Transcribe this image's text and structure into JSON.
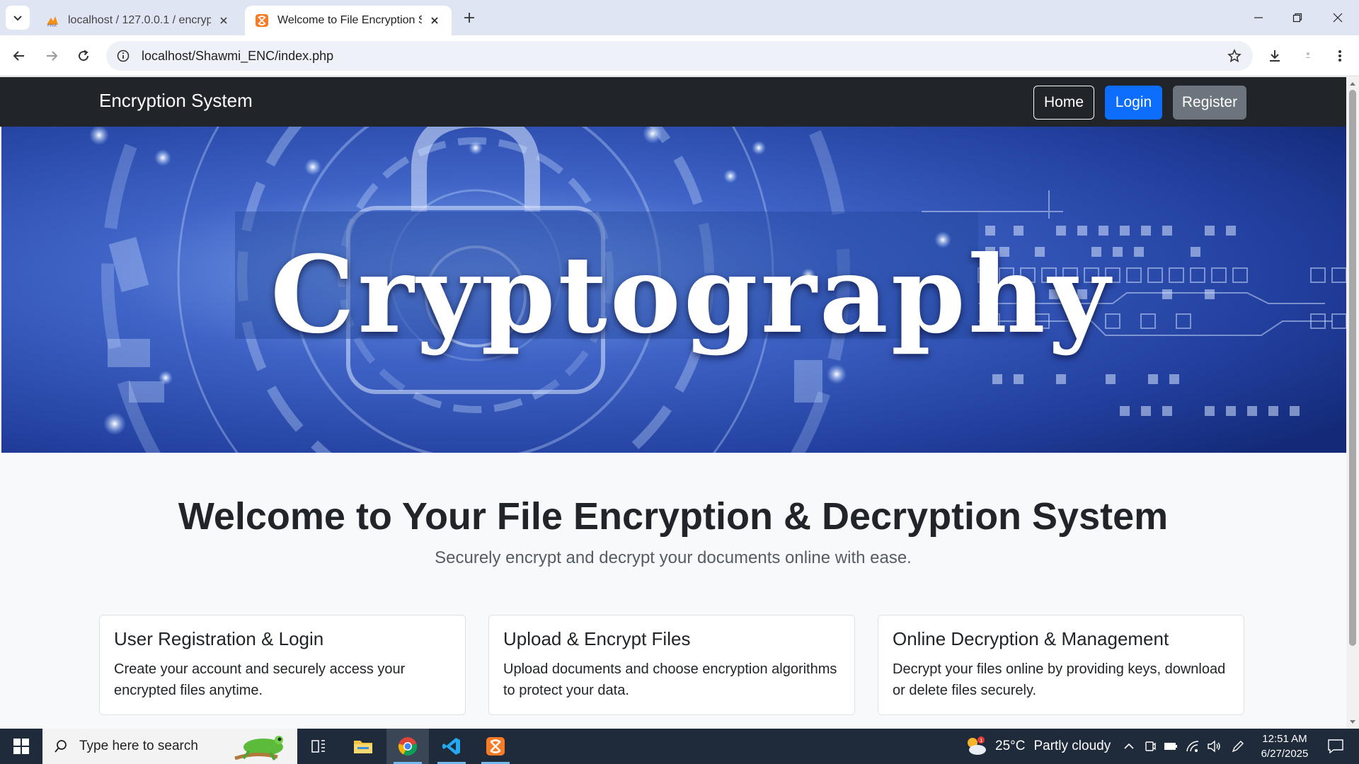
{
  "browser": {
    "tabs": [
      {
        "title": "localhost / 127.0.0.1 / encryptio",
        "favicon": "phpmyadmin-icon",
        "active": false
      },
      {
        "title": "Welcome to File Encryption Syst",
        "favicon": "xampp-icon",
        "active": true
      }
    ],
    "url": "localhost/Shawmi_ENC/index.php"
  },
  "navbar": {
    "brand": "Encryption System",
    "home_label": "Home",
    "login_label": "Login",
    "register_label": "Register"
  },
  "hero": {
    "text": "Cryptography"
  },
  "main": {
    "heading": "Welcome to Your File Encryption & Decryption System",
    "subtitle": "Securely encrypt and decrypt your documents online with ease.",
    "cards": [
      {
        "title": "User Registration & Login",
        "text": "Create your account and securely access your encrypted files anytime."
      },
      {
        "title": "Upload & Encrypt Files",
        "text": "Upload documents and choose encryption algorithms to protect your data."
      },
      {
        "title": "Online Decryption & Management",
        "text": "Decrypt your files online by providing keys, download or delete files securely."
      }
    ]
  },
  "taskbar": {
    "search_placeholder": "Type here to search",
    "weather_temp": "25°C",
    "weather_desc": "Partly cloudy",
    "time": "12:51 AM",
    "date": "6/27/2025"
  },
  "colors": {
    "navbar_bg": "#212529",
    "login_btn": "#0d6efd",
    "register_btn": "#6c757d",
    "hero_blue": "#2a4fae"
  }
}
